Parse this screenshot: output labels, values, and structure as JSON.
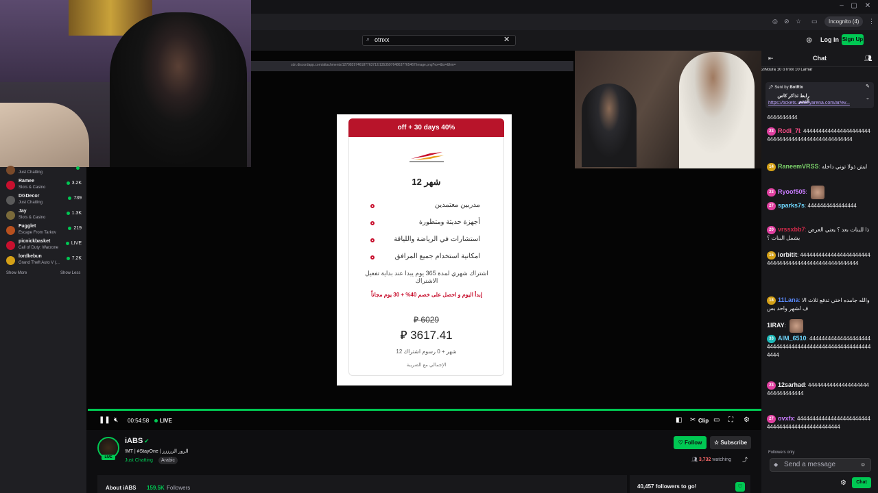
{
  "browser": {
    "incognito_label": "Incognito (4)"
  },
  "topnav": {
    "search_value": "otnxx",
    "login_label": "Log In",
    "signup_label": "Sign Up"
  },
  "sidebar": {
    "items": [
      {
        "name": "",
        "game": "Just Chatting",
        "viewers": "",
        "color": "#7a4a2a"
      },
      {
        "name": "Ramee",
        "game": "Slots & Casino",
        "viewers": "3.2K",
        "color": "#c8102e"
      },
      {
        "name": "DGDecor",
        "game": "Just Chatting",
        "viewers": "739",
        "color": "#5a5a5a"
      },
      {
        "name": "Jay",
        "game": "Slots & Casino",
        "viewers": "1.3K",
        "color": "#7a6a3a"
      },
      {
        "name": "Fugglet",
        "game": "Escape From Tarkov",
        "viewers": "219",
        "color": "#b8501e"
      },
      {
        "name": "picnickbasket",
        "game": "Call of Duty: Warzone",
        "viewers": "LIVE",
        "color": "#c8102e"
      },
      {
        "name": "lordkebun",
        "game": "Grand Theft Auto V (...",
        "viewers": "7.2K",
        "color": "#d4a017"
      }
    ],
    "show_more": "Show More",
    "show_less": "Show Less"
  },
  "promo": {
    "banner": "off + 30 days 40%",
    "title": "12 شهر",
    "features": [
      "مدربين معتمدين",
      "أجهزة حديثة ومتطورة",
      "استشارات في الرياضة واللياقة",
      "امكانية استخدام جميع المرافق"
    ],
    "desc": "اشتراك شهري لمدة 365 يوم يبدا عند بداية تفعيل الاشتراك",
    "offer": "إبدأ اليوم و احصل على خصم 40% + 30 يوم مجاناً",
    "old_price": "6029",
    "new_price": "3617.41",
    "subline": "12 شهر + 0 رسوم اشتراك",
    "tax": "الإجمالي مع الضريبة",
    "currency_symbol": "⃁"
  },
  "player": {
    "elapsed": "00:54:58",
    "live": "LIVE",
    "clip_label": "Clip"
  },
  "channel": {
    "name": "iABS",
    "title": "!MT | #StayOne | الرور الزرززز",
    "category": "Just Chatting",
    "tag": "Arabic",
    "follow_label": "Follow",
    "subscribe_label": "Subscribe",
    "viewers": "3,732",
    "watching_label": "watching",
    "avatar_live": "LIVE"
  },
  "about": {
    "label": "About iABS",
    "followers": "159.5K",
    "followers_label": "Followers"
  },
  "goal": {
    "label": "40,457 followers to go!"
  },
  "chat": {
    "title": "Chat",
    "gifters": "2iNoura 10   oTnxx 10   Lamar",
    "pinned_sent_by": "Sent by",
    "pinned_sender": "BotRix",
    "pinned_text": "رابط تذاكر كاس النجم",
    "pinned_url": "https://tickets.victoryarena.com/ar/ev...",
    "messages": [
      {
        "badge": "",
        "badge_color": "",
        "user": "",
        "user_color": "#efeff1",
        "text": "4444444444"
      },
      {
        "badge": "23",
        "badge_color": "#e040a0",
        "user": "Rodi_7l",
        "user_color": "#ff4f8b",
        "text": "44444444444444444444444444444444444444444444444444"
      },
      {
        "badge": "14",
        "badge_color": "#d4a017",
        "user": "RaneemVRSS",
        "user_color": "#7cd36b",
        "text": "ايش ذولا توني داخله"
      },
      {
        "badge": "23",
        "badge_color": "#e040a0",
        "user": "Ryoof505",
        "user_color": "#c97cff",
        "text": ""
      },
      {
        "badge": "27",
        "badge_color": "#e040a0",
        "user": "sparks7s",
        "user_color": "#6fd8ff",
        "text": "4444444444444444"
      },
      {
        "badge": "20",
        "badge_color": "#e040a0",
        "user": "vrssxbb7",
        "user_color": "#d12a4a",
        "text": "ذا للبنات بعد ؟ يعني العرض يشمل البنات ؟"
      },
      {
        "badge": "15",
        "badge_color": "#d4a017",
        "user": "iorbitit",
        "user_color": "#efeff1",
        "text": "44444444444444444444444444444444444444444444444444444"
      },
      {
        "badge": "18",
        "badge_color": "#d4a017",
        "user": "11Lana",
        "user_color": "#5b8cff",
        "text": "والله جامده اختي تدفع ثلاث الاف لشهر واحد بس"
      },
      {
        "badge": "",
        "badge_color": "",
        "user": "1IRAY",
        "user_color": "#efeff1",
        "text": ""
      },
      {
        "badge": "33",
        "badge_color": "#1fb8b8",
        "user": "AIM_6510",
        "user_color": "#6fd8ff",
        "text": "4444444444444444444444444444444444444444444444444444444444"
      },
      {
        "badge": "23",
        "badge_color": "#e040a0",
        "user": "12sarhad",
        "user_color": "#efeff1",
        "text": "44444444444444444444444444444444"
      },
      {
        "badge": "27",
        "badge_color": "#e040a0",
        "user": "ovxfx",
        "user_color": "#c97cff",
        "text": "444444444444444444444444444444444444444444444444"
      }
    ],
    "followers_only": "Followers only",
    "input_placeholder": "Send a message",
    "send_label": "Chat"
  },
  "colors": {
    "accent": "#00c853",
    "promo_red": "#b8142a",
    "background": "#0e0e10"
  }
}
